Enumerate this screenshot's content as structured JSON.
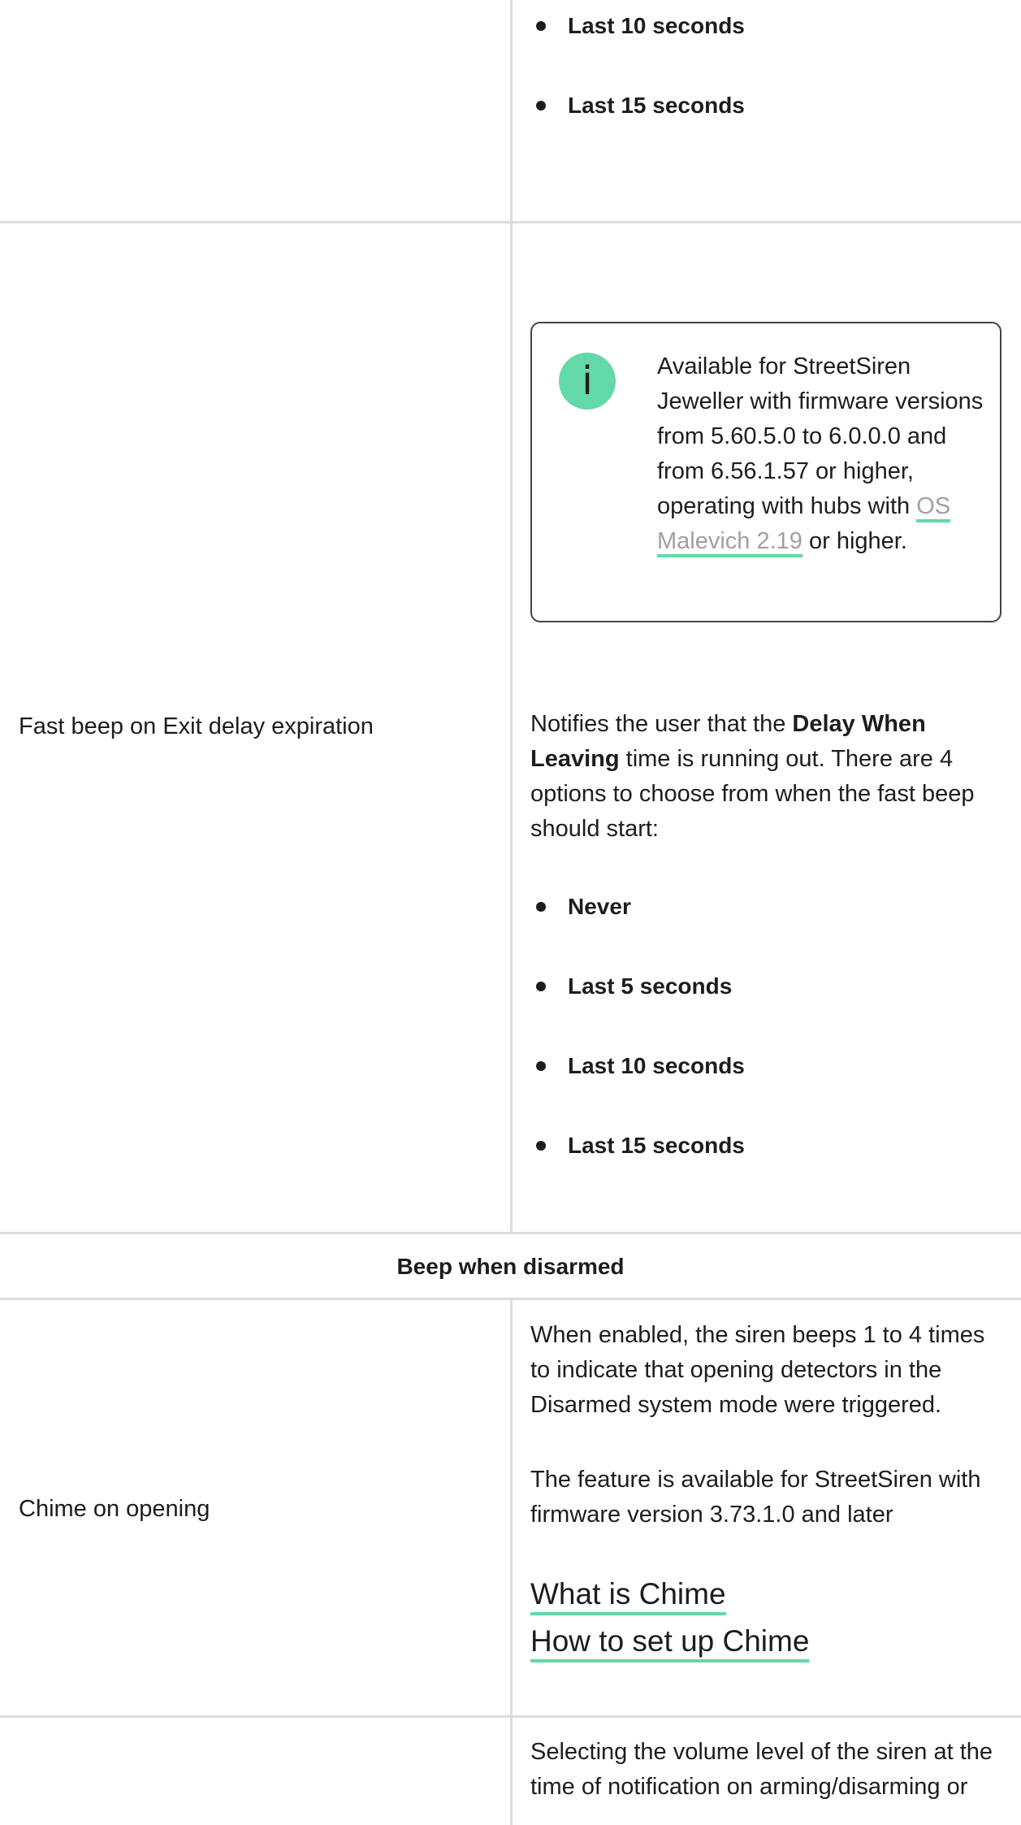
{
  "rows": {
    "row1": {
      "bullets": [
        "Last 10 seconds",
        "Last 15 seconds"
      ]
    },
    "row2": {
      "label": "Fast beep on Exit delay expiration",
      "note": {
        "icon": "info-icon",
        "icon_glyph": "i",
        "text_before": "Available for StreetSiren Jeweller with firmware versions from 5.60.5.0 to 6.0.0.0 and from 6.56.1.57 or higher, operating with hubs with ",
        "link": "OS Malevich 2.19",
        "text_after": " or higher."
      },
      "desc_before": "Notifies the user that the ",
      "desc_bold": "Delay When Leaving",
      "desc_after": " time is running out. There are 4 options to choose from when the fast beep should start:",
      "bullets": [
        "Never",
        "Last 5 seconds",
        "Last 10 seconds",
        "Last 15 seconds"
      ]
    },
    "section_title": "Beep when disarmed",
    "row3": {
      "label": "Chime on opening",
      "para1": "When enabled, the siren beeps 1 to 4 times to indicate that opening detectors in the Disarmed system mode were triggered.",
      "para2": "The feature is available for StreetSiren with firmware version 3.73.1.0 and later",
      "links": [
        "What is Chime",
        "How to set up Chime"
      ]
    },
    "row4": {
      "para": "Selecting the volume level of the siren at the time of notification on arming/disarming or"
    }
  },
  "colors": {
    "accent": "#62d9a6",
    "border": "#dcdcdc",
    "text": "#1d1d1d",
    "link_gray": "#a0a0a0"
  }
}
